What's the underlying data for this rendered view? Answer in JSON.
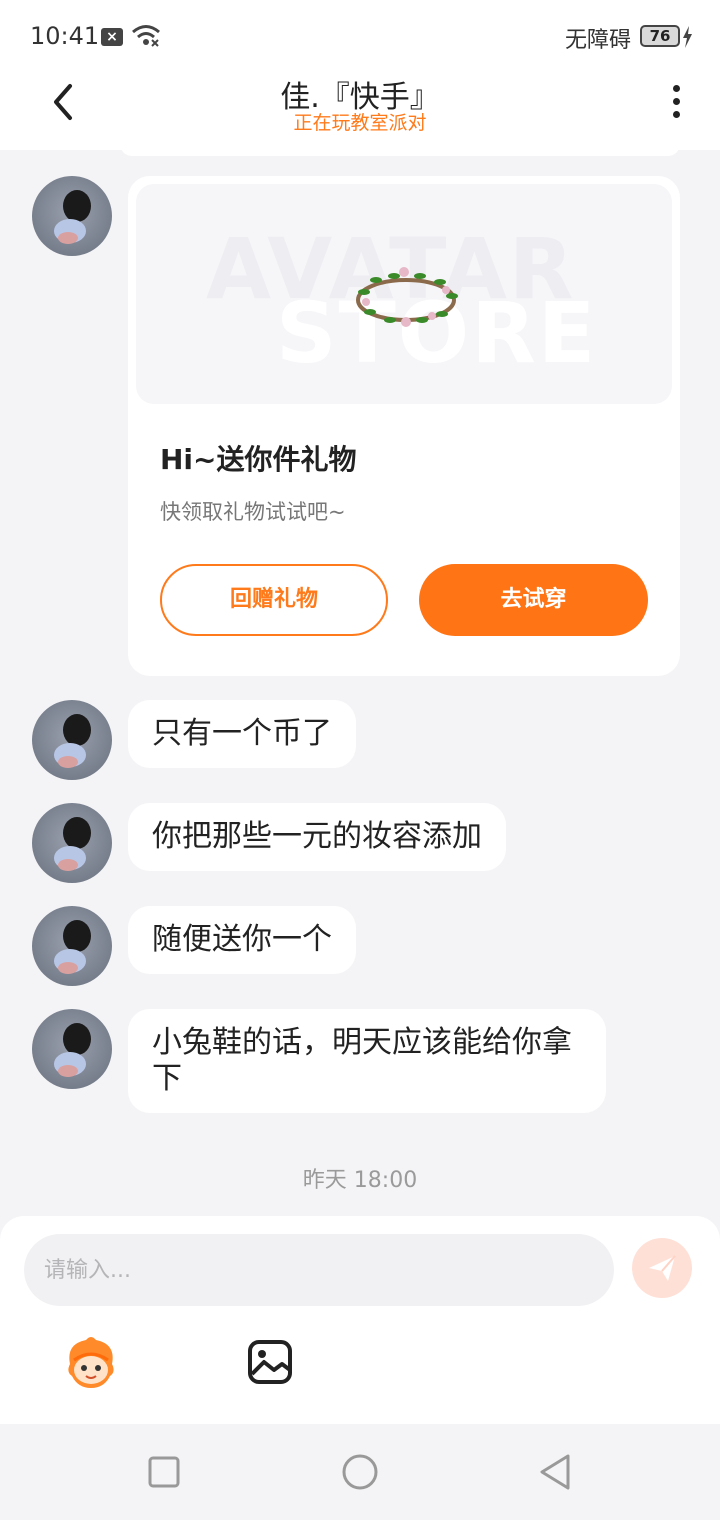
{
  "status_bar": {
    "time": "10:41",
    "accessibility": "无障碍",
    "battery": "76"
  },
  "header": {
    "title": "佳.『快手』",
    "subtitle": "正在玩教室派对"
  },
  "gift_card": {
    "banner_word1": "AVATAR",
    "banner_word2": "STORE",
    "title": "Hi~送你件礼物",
    "description": "快领取礼物试试吧~",
    "return_gift_label": "回赠礼物",
    "try_on_label": "去试穿"
  },
  "messages": [
    {
      "text": "只有一个币了"
    },
    {
      "text": "你把那些一元的妆容添加"
    },
    {
      "text": "随便送你一个"
    },
    {
      "text": "小兔鞋的话，明天应该能给你拿下"
    }
  ],
  "timestamp": "昨天 18:00",
  "composer": {
    "placeholder": "请输入..."
  },
  "colors": {
    "accent": "#ff7414",
    "subtitle": "#ff7a1a",
    "background": "#f4f4f7"
  },
  "icons": [
    "back-arrow-icon",
    "more-vertical-icon",
    "wreath-icon",
    "send-icon",
    "emoji-mascot-icon",
    "image-icon",
    "nav-square-icon",
    "nav-circle-icon",
    "nav-triangle-icon"
  ]
}
